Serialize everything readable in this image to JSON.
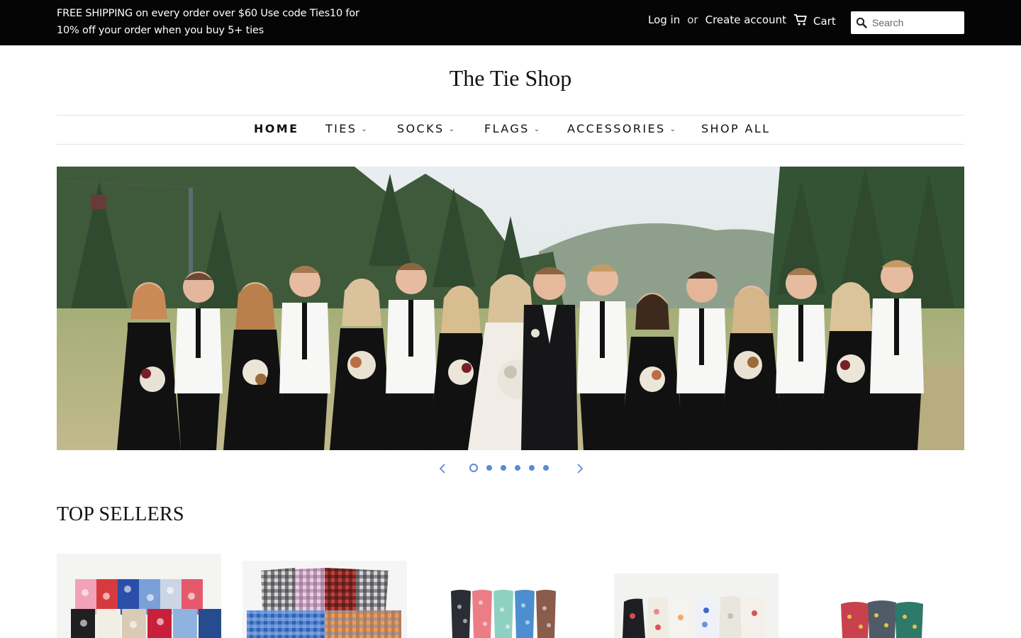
{
  "topbar": {
    "promo": "FREE SHIPPING on every order over $60 Use code Ties10 for 10% off your order when you buy 5+ ties",
    "login": "Log in",
    "or": "or",
    "create_account": "Create account",
    "cart": "Cart",
    "search_placeholder": "Search"
  },
  "logo": "The Tie Shop",
  "nav": {
    "items": [
      {
        "label": "HOME"
      },
      {
        "label": "TIES"
      },
      {
        "label": "SOCKS"
      },
      {
        "label": "FLAGS"
      },
      {
        "label": "ACCESSORIES"
      },
      {
        "label": "SHOP ALL"
      }
    ]
  },
  "slideshow": {
    "slide_count": 6,
    "active_index": 0
  },
  "section_title": "TOP SELLERS",
  "colors": {
    "topbar_bg": "#050505",
    "accent_dots": "#5b8bd6"
  }
}
